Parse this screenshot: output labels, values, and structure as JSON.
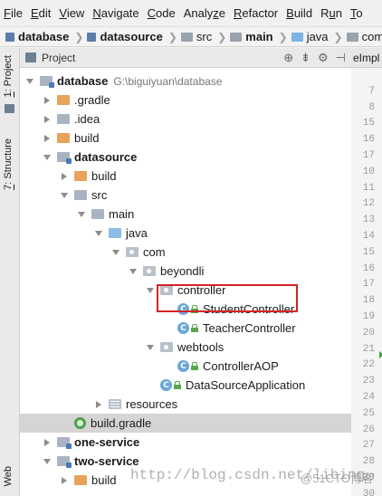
{
  "menu": [
    {
      "pre": "",
      "ul": "F",
      "post": "ile"
    },
    {
      "pre": "",
      "ul": "E",
      "post": "dit"
    },
    {
      "pre": "",
      "ul": "V",
      "post": "iew"
    },
    {
      "pre": "",
      "ul": "N",
      "post": "avigate"
    },
    {
      "pre": "",
      "ul": "C",
      "post": "ode"
    },
    {
      "pre": "Analy",
      "ul": "z",
      "post": "e"
    },
    {
      "pre": "",
      "ul": "R",
      "post": "efactor"
    },
    {
      "pre": "",
      "ul": "B",
      "post": "uild"
    },
    {
      "pre": "R",
      "ul": "u",
      "post": "n"
    },
    {
      "pre": "",
      "ul": "T",
      "post": "o"
    }
  ],
  "breadcrumbs": [
    "database",
    "datasource",
    "src",
    "main",
    "java",
    "com"
  ],
  "left_tabs": {
    "project": {
      "num": "1",
      "label": ": Project"
    },
    "structure": {
      "num": "7",
      "label": ": Structure"
    },
    "web": "Web"
  },
  "panel": {
    "title": "Project",
    "tool_icons": [
      "globe-icon",
      "collapse-icon",
      "settings-icon",
      "hide-icon"
    ]
  },
  "tree": [
    {
      "label": "database",
      "path": "G:\\biguiyuan\\database",
      "bold": true,
      "icon": "folder-module",
      "arrow": "down",
      "indent": 0
    },
    {
      "label": ".gradle",
      "icon": "folder-orange",
      "arrow": "right",
      "indent": 1
    },
    {
      "label": ".idea",
      "icon": "folder-gray",
      "arrow": "right",
      "indent": 1
    },
    {
      "label": "build",
      "icon": "folder-orange",
      "arrow": "right",
      "indent": 1
    },
    {
      "label": "datasource",
      "bold": true,
      "icon": "folder-module",
      "arrow": "down",
      "indent": 1
    },
    {
      "label": "build",
      "icon": "folder-orange",
      "arrow": "right",
      "indent": 2
    },
    {
      "label": "src",
      "icon": "folder-gray",
      "arrow": "down",
      "indent": 2
    },
    {
      "label": "main",
      "icon": "folder-gray",
      "arrow": "down",
      "indent": 3
    },
    {
      "label": "java",
      "icon": "folder-blue",
      "arrow": "down",
      "indent": 4
    },
    {
      "label": "com",
      "icon": "package",
      "arrow": "down",
      "indent": 5
    },
    {
      "label": "beyondli",
      "icon": "package",
      "arrow": "down",
      "indent": 6
    },
    {
      "label": "controller",
      "icon": "package",
      "arrow": "down",
      "indent": 7
    },
    {
      "label": "StudentController",
      "icon": "class",
      "arrow": "none",
      "indent": 8
    },
    {
      "label": "TeacherController",
      "icon": "class",
      "arrow": "none",
      "indent": 8
    },
    {
      "label": "webtools",
      "icon": "package",
      "arrow": "down",
      "indent": 7
    },
    {
      "label": "ControllerAOP",
      "icon": "class",
      "arrow": "none",
      "indent": 8
    },
    {
      "label": "DataSourceApplication",
      "icon": "class",
      "arrow": "none",
      "indent": 7
    },
    {
      "label": "resources",
      "icon": "resources",
      "arrow": "right",
      "indent": 4
    },
    {
      "label": "build.gradle",
      "icon": "gradle",
      "arrow": "none",
      "indent": 2,
      "selected": true
    },
    {
      "label": "one-service",
      "bold": true,
      "icon": "folder-module",
      "arrow": "right",
      "indent": 1
    },
    {
      "label": "two-service",
      "bold": true,
      "icon": "folder-module",
      "arrow": "down",
      "indent": 1
    },
    {
      "label": "build",
      "icon": "folder-orange",
      "arrow": "right",
      "indent": 2
    }
  ],
  "editor_tab": "eImpl",
  "gutter_lines": [
    "",
    "7",
    "8",
    "15",
    "16",
    "17",
    "10",
    "11",
    "12",
    "13",
    "14",
    "15",
    "16",
    "17",
    "18",
    "19",
    "20",
    "21",
    "22",
    "23",
    "24",
    "25",
    "26",
    "27",
    "28",
    "29",
    "30"
  ],
  "watermark": "http://blog.csdn.net/libing",
  "watermark2": "@51CTO博客"
}
